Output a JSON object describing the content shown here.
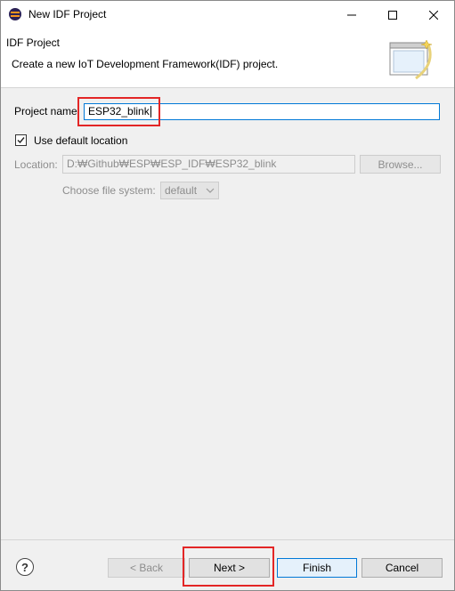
{
  "window": {
    "title": "New IDF Project",
    "minimize_glyph": "—",
    "maximize_glyph": "☐",
    "close_glyph": "✕"
  },
  "header": {
    "title": "IDF Project",
    "description": "Create a new IoT Development Framework(IDF) project."
  },
  "form": {
    "project_name_label": "Project name",
    "project_name_value": "ESP32_blink",
    "use_default_location_label": "Use default location",
    "use_default_location_checked": true,
    "location_label": "Location:",
    "location_value": "D:₩Github₩ESP₩ESP_IDF₩ESP32_blink",
    "browse_label": "Browse...",
    "file_system_label": "Choose file system:",
    "file_system_value": "default"
  },
  "footer": {
    "help_glyph": "?",
    "back_label": "< Back",
    "next_label": "Next >",
    "finish_label": "Finish",
    "cancel_label": "Cancel"
  },
  "colors": {
    "highlight_box": "#e32626",
    "focus_border": "#0078d7",
    "disabled_text": "#8d8d8d"
  },
  "icons": [
    "eclipse-app-icon",
    "minimize-icon",
    "maximize-icon",
    "close-icon",
    "wizard-banner-icon",
    "checkmark-icon",
    "chevron-down-icon",
    "help-icon"
  ]
}
